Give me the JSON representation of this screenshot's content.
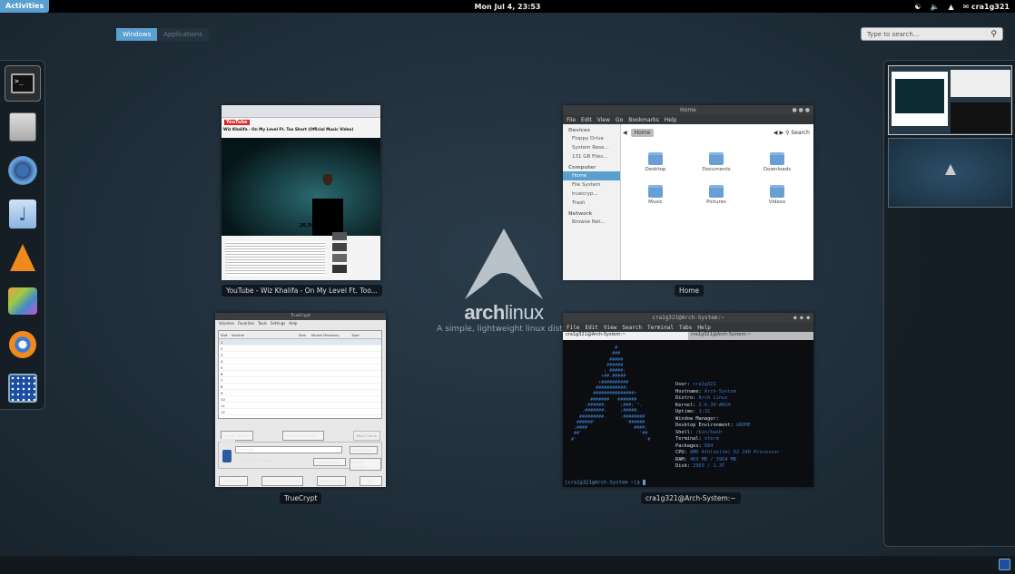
{
  "top_panel": {
    "activities": "Activities",
    "clock": "Mon Jul  4, 23:53",
    "user": "cra1g321"
  },
  "view_tabs": {
    "windows": "Windows",
    "applications": "Applications"
  },
  "search": {
    "placeholder": "Type to search..."
  },
  "arch": {
    "word_a": "arch",
    "word_b": "linux",
    "tagline": "A simple, lightweight linux distro"
  },
  "windows": {
    "youtube": {
      "caption": "YouTube - Wiz Khalifa - On My Level Ft. Too...",
      "page_title": "Wiz Khalifa - On My Level Ft. Too Short (Official Music Video)",
      "views": "26,561,761"
    },
    "nautilus": {
      "caption": "Home",
      "title": "Home",
      "menu": [
        "File",
        "Edit",
        "View",
        "Go",
        "Bookmarks",
        "Help"
      ],
      "location": "Home",
      "search": "Search",
      "sidebar": {
        "devices_h": "Devices",
        "devices": [
          "Floppy Drive",
          "System Rese...",
          "131 GB Files..."
        ],
        "computer_h": "Computer",
        "computer": [
          "Home",
          "File System",
          "truecryp...",
          "Trash"
        ],
        "network_h": "Network",
        "network": [
          "Browse Net..."
        ]
      },
      "folders": [
        "Desktop",
        "Documents",
        "Downloads",
        "Music",
        "Pictures",
        "Videos"
      ]
    },
    "truecrypt": {
      "caption": "TrueCrypt",
      "title": "TrueCrypt",
      "menu": [
        "Volumes",
        "Favorites",
        "Tools",
        "Settings",
        "Help"
      ],
      "columns": [
        "Slot",
        "Volume",
        "Size",
        "Mount Directory",
        "Type"
      ],
      "slots": [
        "1",
        "2",
        "3",
        "4",
        "5",
        "6",
        "7",
        "8",
        "9",
        "10",
        "11",
        "12"
      ],
      "buttons": {
        "create": "Create Volume",
        "props": "Volume Properties...",
        "wipe": "Wipe Cache",
        "select_file": "Select File...",
        "tools": "Volume Tools...",
        "select_device": "Select Device...",
        "dismount": "Dismount",
        "automount": "Auto-Mount Devices",
        "dismount_all": "Dismount All",
        "exit": "Exit"
      },
      "volume_label": "Volume",
      "volume_value": "/dev/sdb",
      "never_save": "Never save history"
    },
    "terminal": {
      "caption": "cra1g321@Arch-System:~",
      "title": "cra1g321@Arch-System:~",
      "menu": [
        "File",
        "Edit",
        "View",
        "Search",
        "Terminal",
        "Tabs",
        "Help"
      ],
      "tabs": [
        "cra1g321@Arch-System:~",
        "cra1g321@Arch-System:~"
      ],
      "info": [
        [
          "User:",
          "cra1g321"
        ],
        [
          "Hostname:",
          "Arch-System"
        ],
        [
          "Distro:",
          "Arch Linux"
        ],
        [
          "Kernel:",
          "2.6.39-ARCH"
        ],
        [
          "Uptime:",
          "1:31"
        ],
        [
          "Window Manager:",
          ""
        ],
        [
          "Desktop Environment:",
          "GNOME"
        ],
        [
          "Shell:",
          "/bin/bash"
        ],
        [
          "Terminal:",
          "xterm"
        ],
        [
          "Packages:",
          "684"
        ],
        [
          "CPU:",
          "AMD Athlon(tm) X2 240 Processor"
        ],
        [
          "RAM:",
          "463 MB / 3964 MB"
        ],
        [
          "Disk:",
          "2965 / 1.3T"
        ]
      ],
      "prompt": "[cra1g321@Arch-System ~]$ "
    }
  }
}
